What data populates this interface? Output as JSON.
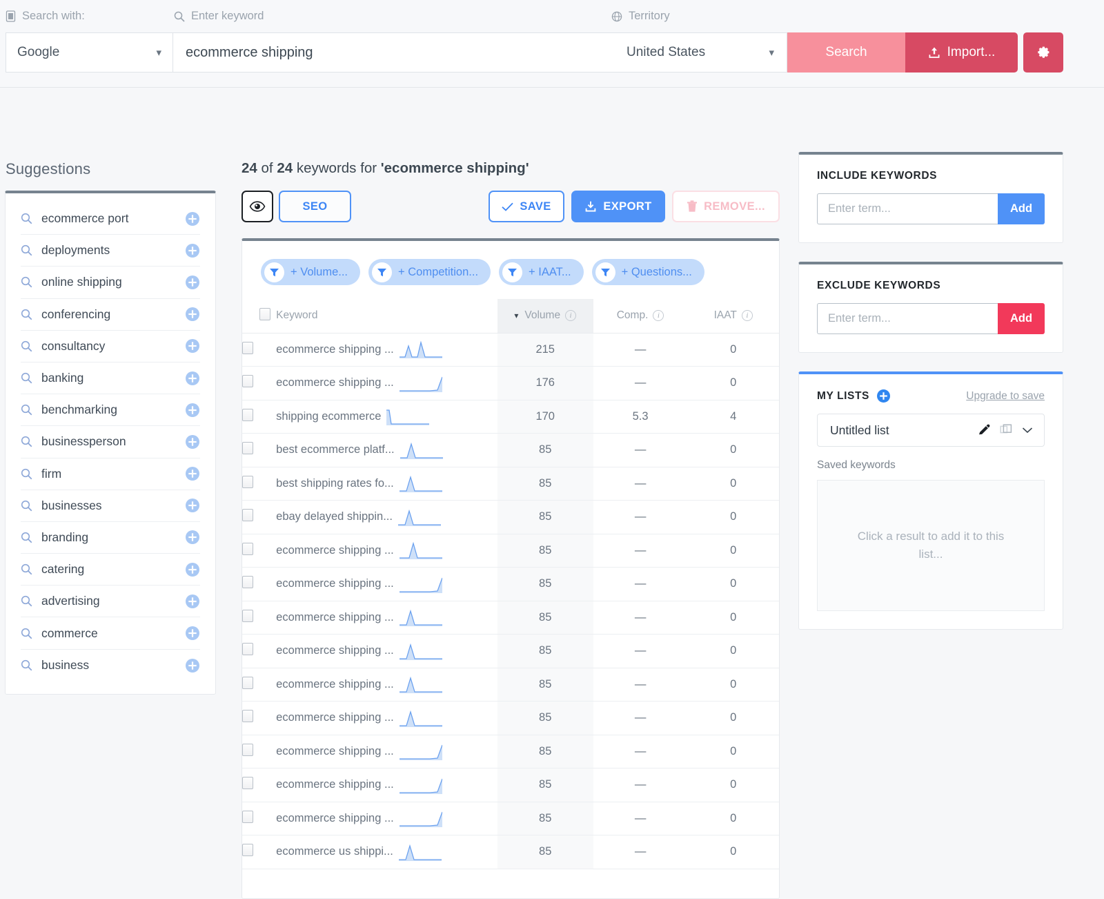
{
  "topbar": {
    "search_with_label": "Search with:",
    "keyword_label": "Enter keyword",
    "territory_label": "Territory",
    "engine_value": "Google",
    "keyword_value": "ecommerce shipping",
    "territory_value": "United States",
    "search_button": "Search",
    "import_button": "Import...",
    "search_button_color": "#f7909c",
    "import_button_color": "#d74a63"
  },
  "suggestions": {
    "title": "Suggestions",
    "items": [
      {
        "label": "ecommerce port"
      },
      {
        "label": "deployments"
      },
      {
        "label": "online shipping"
      },
      {
        "label": "conferencing"
      },
      {
        "label": "consultancy"
      },
      {
        "label": "banking"
      },
      {
        "label": "benchmarking"
      },
      {
        "label": "businessperson"
      },
      {
        "label": "firm"
      },
      {
        "label": "businesses"
      },
      {
        "label": "branding"
      },
      {
        "label": "catering"
      },
      {
        "label": "advertising"
      },
      {
        "label": "commerce"
      },
      {
        "label": "business"
      }
    ]
  },
  "main": {
    "heading": {
      "shown": "24",
      "of": "of",
      "total": "24",
      "middle": "keywords for",
      "query": "'ecommerce shipping'"
    },
    "toolbar": {
      "seo_label": "SEO",
      "save_label": "SAVE",
      "export_label": "EXPORT",
      "remove_label": "REMOVE..."
    },
    "filters": [
      {
        "label": "+ Volume..."
      },
      {
        "label": "+ Competition..."
      },
      {
        "label": "+ IAAT..."
      },
      {
        "label": "+ Questions..."
      }
    ],
    "table": {
      "columns": [
        "Keyword",
        "Volume",
        "Comp.",
        "IAAT"
      ],
      "sorted_by": "Volume",
      "rows": [
        {
          "keyword": "ecommerce shipping ...",
          "volume": "215",
          "comp": "—",
          "iaat": "0",
          "spark": "double-peak"
        },
        {
          "keyword": "ecommerce shipping ...",
          "volume": "176",
          "comp": "—",
          "iaat": "0",
          "spark": "rising-end"
        },
        {
          "keyword": "shipping ecommerce",
          "volume": "170",
          "comp": "5.3",
          "iaat": "4",
          "spark": "drop-start"
        },
        {
          "keyword": "best ecommerce platf...",
          "volume": "85",
          "comp": "—",
          "iaat": "0",
          "spark": "peak-left"
        },
        {
          "keyword": "best shipping rates fo...",
          "volume": "85",
          "comp": "—",
          "iaat": "0",
          "spark": "peak-left"
        },
        {
          "keyword": "ebay delayed shippin...",
          "volume": "85",
          "comp": "—",
          "iaat": "0",
          "spark": "peak-left"
        },
        {
          "keyword": "ecommerce shipping ...",
          "volume": "85",
          "comp": "—",
          "iaat": "0",
          "spark": "peak-mid"
        },
        {
          "keyword": "ecommerce shipping ...",
          "volume": "85",
          "comp": "—",
          "iaat": "0",
          "spark": "rising-end"
        },
        {
          "keyword": "ecommerce shipping ...",
          "volume": "85",
          "comp": "—",
          "iaat": "0",
          "spark": "peak-left"
        },
        {
          "keyword": "ecommerce shipping ...",
          "volume": "85",
          "comp": "—",
          "iaat": "0",
          "spark": "peak-left"
        },
        {
          "keyword": "ecommerce shipping ...",
          "volume": "85",
          "comp": "—",
          "iaat": "0",
          "spark": "peak-left"
        },
        {
          "keyword": "ecommerce shipping ...",
          "volume": "85",
          "comp": "—",
          "iaat": "0",
          "spark": "peak-left"
        },
        {
          "keyword": "ecommerce shipping ...",
          "volume": "85",
          "comp": "—",
          "iaat": "0",
          "spark": "rising-end"
        },
        {
          "keyword": "ecommerce shipping ...",
          "volume": "85",
          "comp": "—",
          "iaat": "0",
          "spark": "rising-end"
        },
        {
          "keyword": "ecommerce shipping ...",
          "volume": "85",
          "comp": "—",
          "iaat": "0",
          "spark": "rising-end"
        },
        {
          "keyword": "ecommerce us shippi...",
          "volume": "85",
          "comp": "—",
          "iaat": "0",
          "spark": "peak-left"
        }
      ]
    }
  },
  "right": {
    "include": {
      "title": "INCLUDE KEYWORDS",
      "placeholder": "Enter term...",
      "add_label": "Add",
      "add_color": "#4f92f7"
    },
    "exclude": {
      "title": "EXCLUDE KEYWORDS",
      "placeholder": "Enter term...",
      "add_label": "Add",
      "add_color": "#f2395a"
    },
    "mylists": {
      "title": "MY LISTS",
      "upgrade_label": "Upgrade to save",
      "selected_list": "Untitled list",
      "saved_label": "Saved keywords",
      "empty_text": "Click a result to add it to this list..."
    }
  }
}
